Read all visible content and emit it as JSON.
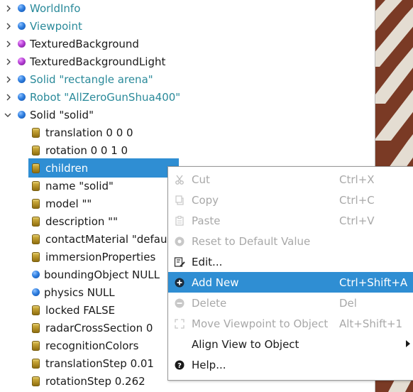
{
  "tree": {
    "items": [
      {
        "label": "WorldInfo",
        "kind": "node-blue",
        "expanded": false
      },
      {
        "label": "Viewpoint",
        "kind": "node-blue",
        "expanded": false
      },
      {
        "label": "TexturedBackground",
        "kind": "node-purple",
        "expanded": false
      },
      {
        "label": "TexturedBackgroundLight",
        "kind": "node-purple",
        "expanded": false
      },
      {
        "label": "Solid \"rectangle arena\"",
        "kind": "node-blue",
        "expanded": false
      },
      {
        "label": "Robot \"AllZeroGunShua400\"",
        "kind": "node-blue",
        "expanded": false
      },
      {
        "label": "Solid \"solid\"",
        "kind": "node-blue",
        "expanded": true
      },
      {
        "label": "translation 0 0 0",
        "kind": "field"
      },
      {
        "label": "rotation 0 0 1 0",
        "kind": "field"
      },
      {
        "label": "children",
        "kind": "field",
        "selected": true
      },
      {
        "label": "name \"solid\"",
        "kind": "field"
      },
      {
        "label": "model \"\"",
        "kind": "field"
      },
      {
        "label": "description \"\"",
        "kind": "field"
      },
      {
        "label": "contactMaterial \"default\"",
        "kind": "field"
      },
      {
        "label": "immersionProperties",
        "kind": "field"
      },
      {
        "label": "boundingObject NULL",
        "kind": "node-blue"
      },
      {
        "label": "physics NULL",
        "kind": "node-blue"
      },
      {
        "label": "locked FALSE",
        "kind": "field"
      },
      {
        "label": "radarCrossSection 0",
        "kind": "field"
      },
      {
        "label": "recognitionColors",
        "kind": "field"
      },
      {
        "label": "translationStep 0.01",
        "kind": "field"
      },
      {
        "label": "rotationStep 0.262",
        "kind": "field"
      }
    ]
  },
  "context_menu": {
    "items": [
      {
        "label": "Cut",
        "shortcut": "Ctrl+X",
        "enabled": false,
        "icon": "scissors-icon"
      },
      {
        "label": "Copy",
        "shortcut": "Ctrl+C",
        "enabled": false,
        "icon": "copy-icon"
      },
      {
        "label": "Paste",
        "shortcut": "Ctrl+V",
        "enabled": false,
        "icon": "paste-icon"
      },
      {
        "label": "Reset to Default Value",
        "shortcut": "",
        "enabled": false,
        "icon": "reset-icon"
      },
      {
        "label": "Edit...",
        "shortcut": "",
        "enabled": true,
        "icon": "edit-icon"
      },
      {
        "label": "Add New",
        "shortcut": "Ctrl+Shift+A",
        "enabled": true,
        "highlighted": true,
        "icon": "add-icon"
      },
      {
        "label": "Delete",
        "shortcut": "Del",
        "enabled": false,
        "icon": "delete-icon"
      },
      {
        "label": "Move Viewpoint to Object",
        "shortcut": "Alt+Shift+1",
        "enabled": false,
        "icon": "move-viewpoint-icon"
      },
      {
        "label": "Align View to Object",
        "shortcut": "",
        "enabled": true,
        "submenu": true,
        "icon": ""
      },
      {
        "label": "Help...",
        "shortcut": "",
        "enabled": true,
        "icon": "help-icon"
      }
    ]
  },
  "colors": {
    "selection": "#2f8ed3",
    "node_label": "#2a8a9a",
    "floor_dark": "#7a3a25",
    "floor_light": "#e4ddd2"
  }
}
